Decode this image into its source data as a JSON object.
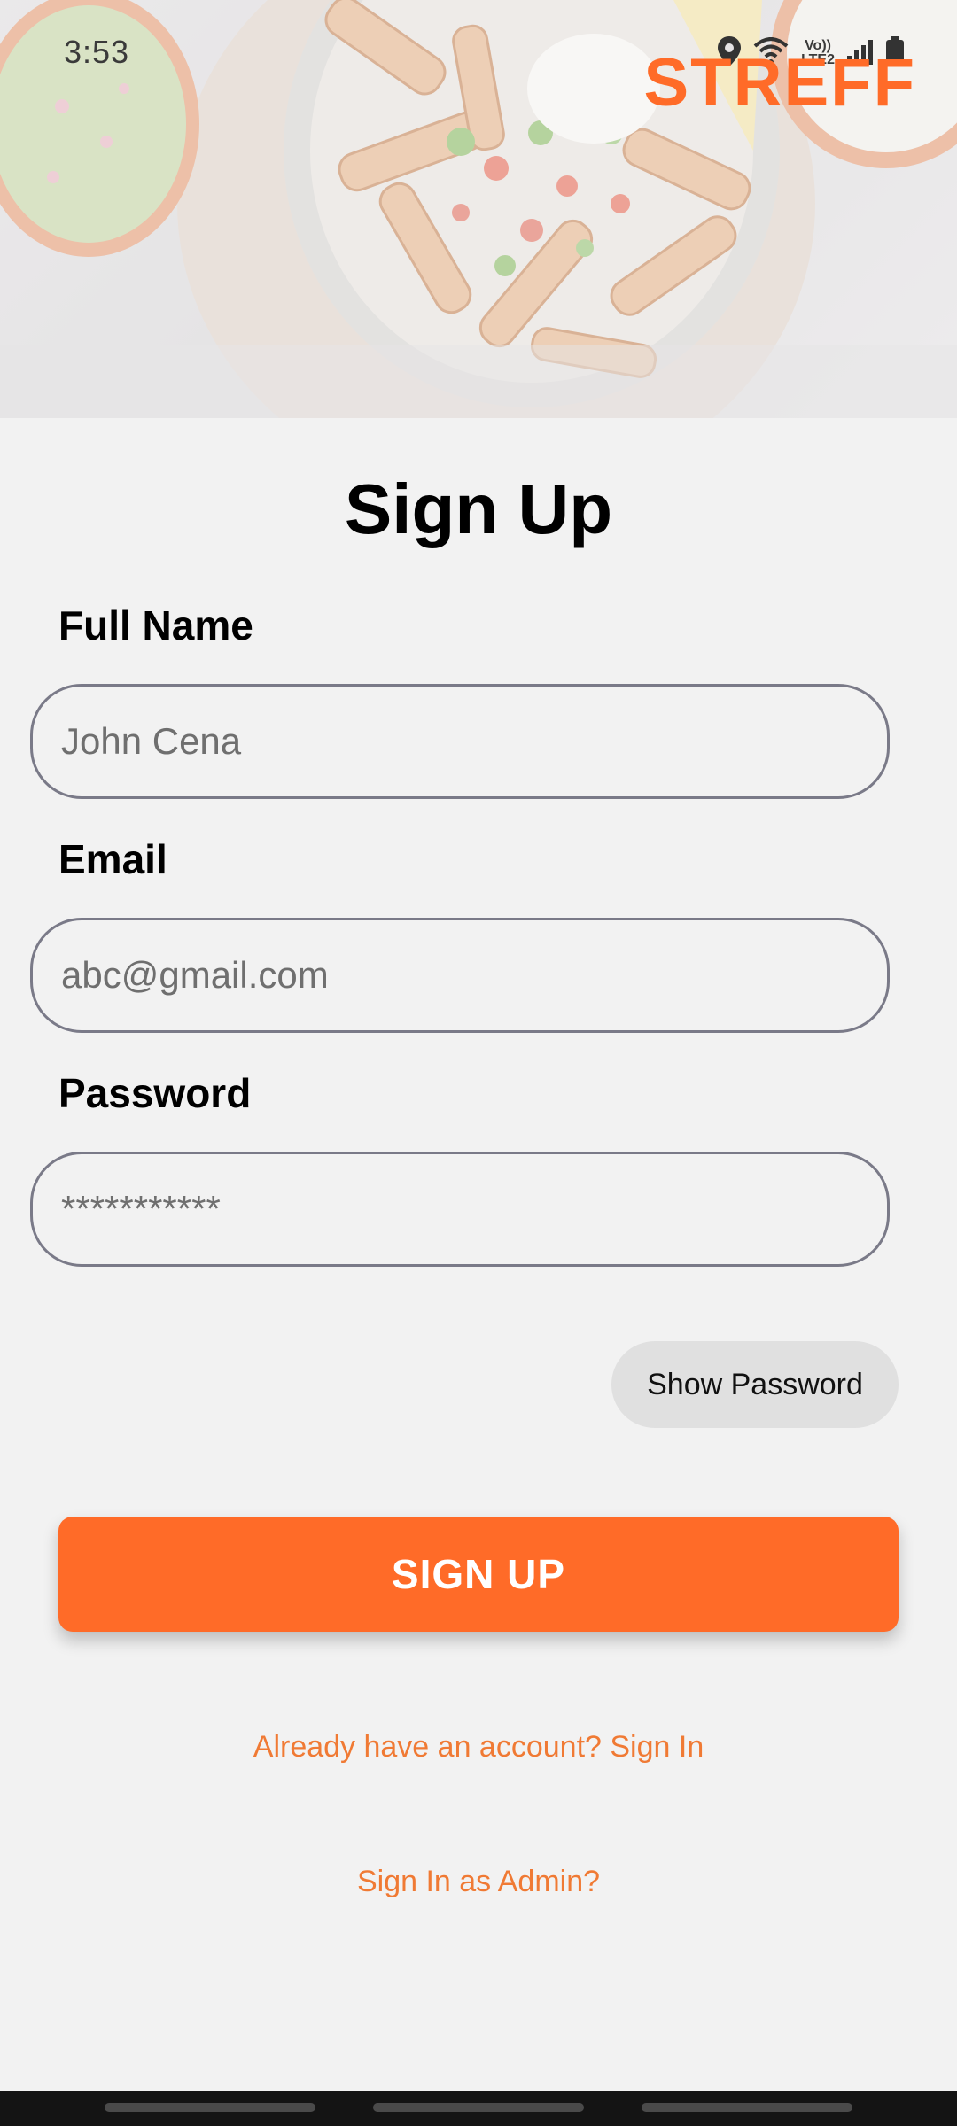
{
  "status_bar": {
    "time": "3:53",
    "network_label_top": "Vo))",
    "network_label_bottom": "LTE2",
    "icons": [
      "location-icon",
      "wifi-icon",
      "signal-icon",
      "battery-icon"
    ]
  },
  "brand": {
    "name": "STREFF",
    "color": "#ff6b28"
  },
  "form": {
    "title": "Sign Up",
    "full_name": {
      "label": "Full Name",
      "placeholder": "John Cena"
    },
    "email": {
      "label": "Email",
      "placeholder": "abc@gmail.com"
    },
    "password": {
      "label": "Password",
      "placeholder": "***********"
    },
    "show_password_label": "Show Password",
    "submit_label": "SIGN UP"
  },
  "links": {
    "sign_in": "Already have an account? Sign In",
    "admin_sign_in": "Sign In as Admin?"
  },
  "colors": {
    "accent": "#ff6b28",
    "link": "#f07a34",
    "background": "#f2f2f2"
  }
}
